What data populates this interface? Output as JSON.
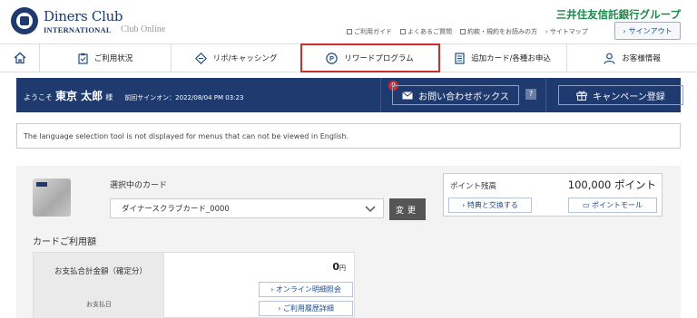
{
  "header": {
    "brand_line1": "Diners Club",
    "brand_line2": "INTERNATIONAL",
    "brand_line3": "Club Online",
    "corporate": "三井住友信託銀行グループ",
    "top_links": [
      "ご利用ガイド",
      "よくあるご質問",
      "約款・規約をお読みの方",
      "サイトマップ"
    ],
    "signout_label": "サインアウト"
  },
  "nav": {
    "items": [
      {
        "label": "ご利用状況",
        "icon": "clipboard-icon"
      },
      {
        "label": "リボ/キャッシング",
        "icon": "diamond-icon"
      },
      {
        "label": "リワードプログラム",
        "icon": "point-icon",
        "active": true
      },
      {
        "label": "追加カード/各種お申込",
        "icon": "document-icon"
      },
      {
        "label": "お客様情報",
        "icon": "user-icon"
      }
    ]
  },
  "welcome": {
    "prefix": "ようこそ",
    "name": "東京 太郎",
    "suffix": "様",
    "last_signon": "前回サインオン：2022/08/04 PM 03:23",
    "badge_count": "0",
    "inquiry_label": "お問い合わせボックス",
    "help_label": "?",
    "campaign_label": "キャンペーン登録"
  },
  "notice": "The language selection tool is not displayed for menus that can not be viewed in English.",
  "card": {
    "selected_label": "選択中のカード",
    "selected_value": "ダイナースクラブカード_0000",
    "change_label": "変更"
  },
  "points": {
    "label": "ポイント残高",
    "value": "100,000 ポイント",
    "exchange_label": "特典と交換する",
    "mall_label": "ポイントモール"
  },
  "usage": {
    "title": "カードご利用額",
    "total_label": "お支払合計金額（確定分）",
    "date_label": "お支払日",
    "amount": "0",
    "amount_unit": "円",
    "online_statement_label": "オンライン明細照会",
    "history_label": "ご利用履歴詳細"
  },
  "colors": {
    "navy": "#1e3a6e",
    "active_outline": "#d12c2c",
    "corporate_green": "#1a8a4a"
  }
}
